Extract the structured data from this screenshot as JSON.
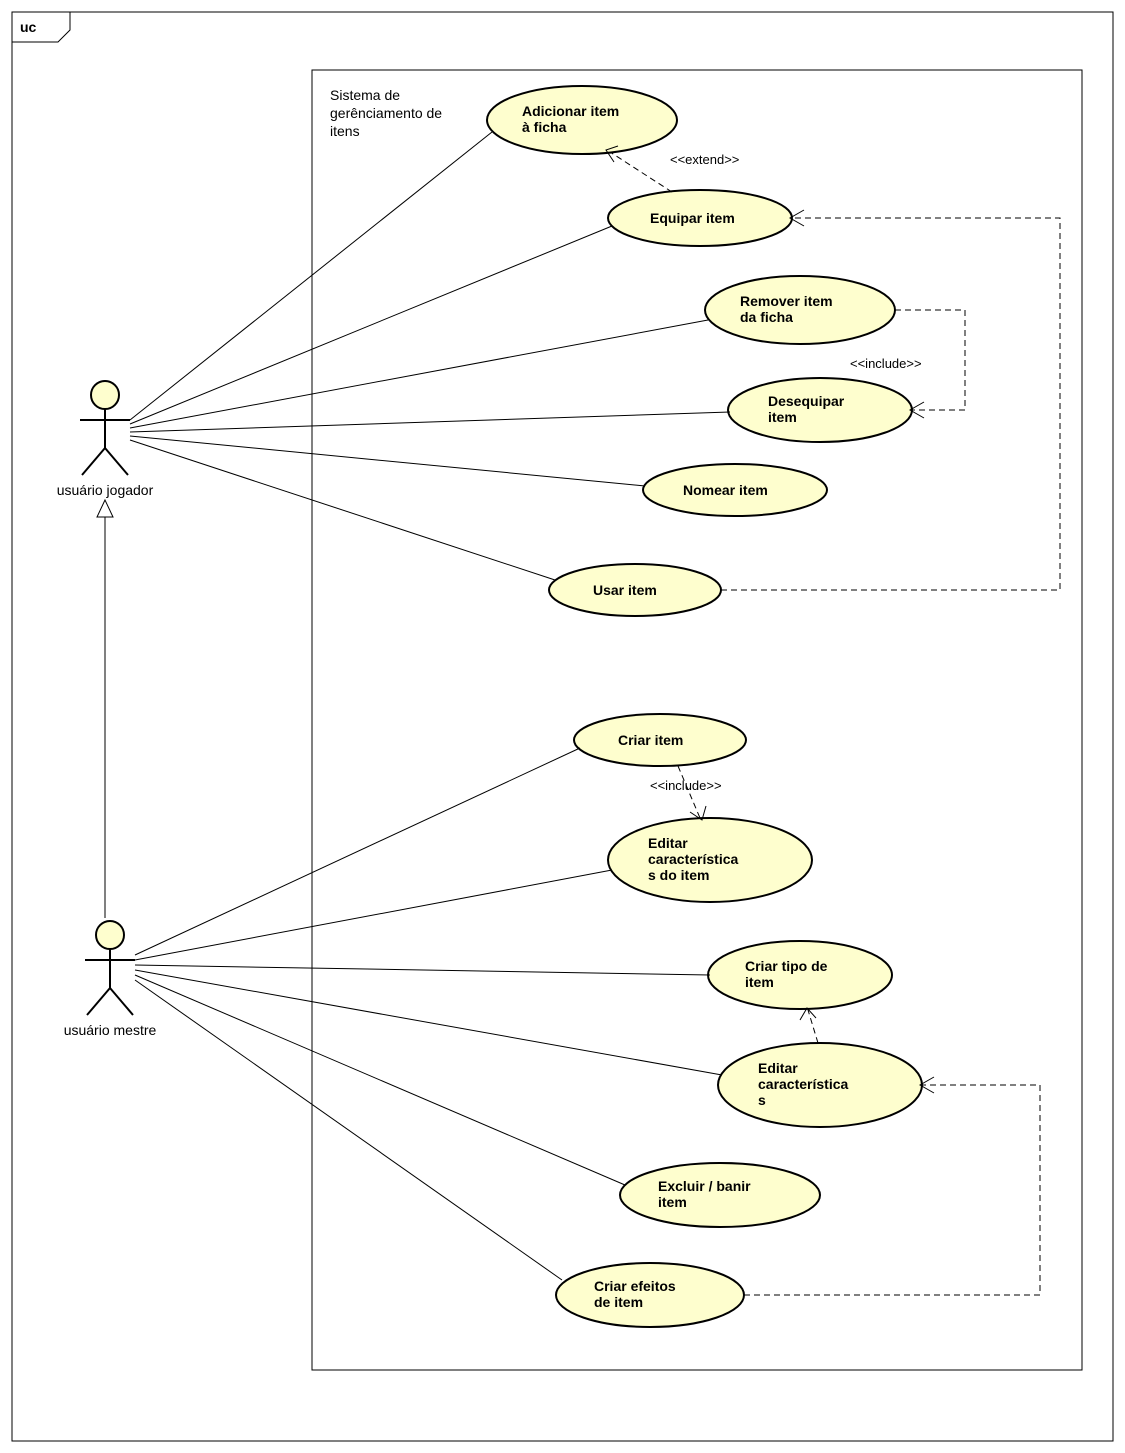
{
  "frame": {
    "label": "uc"
  },
  "system": {
    "title": "Sistema de\ngerênciamento de\nitens"
  },
  "actors": {
    "player": {
      "label": "usuário jogador"
    },
    "master": {
      "label": "usuário mestre"
    }
  },
  "usecases": {
    "addItem": {
      "label": "Adicionar item\nà ficha"
    },
    "equipItem": {
      "label": "Equipar item"
    },
    "removeItem": {
      "label": "Remover item\nda ficha"
    },
    "unequipItem": {
      "label": "Desequipar\nitem"
    },
    "nameItem": {
      "label": "Nomear item"
    },
    "useItem": {
      "label": "Usar item"
    },
    "createItem": {
      "label": "Criar item"
    },
    "editItemChar": {
      "label": "Editar\ncaracterística\ns do item"
    },
    "createItemType": {
      "label": "Criar tipo de\nitem"
    },
    "editChar": {
      "label": "Editar\ncaracterística\ns"
    },
    "deleteBan": {
      "label": "Excluir / banir\nitem"
    },
    "createEffects": {
      "label": "Criar efeitos\nde item"
    }
  },
  "relations": {
    "extend": {
      "label": "<<extend>>"
    },
    "include": {
      "label": "<<include>>"
    }
  },
  "chart_data": {
    "type": "uml_use_case",
    "frame_label": "uc",
    "system_boundary": "Sistema de gerênciamento de itens",
    "actors": [
      {
        "id": "player",
        "name": "usuário jogador"
      },
      {
        "id": "master",
        "name": "usuário mestre",
        "generalizes": "player"
      }
    ],
    "use_cases": [
      {
        "id": "addItem",
        "name": "Adicionar item à ficha"
      },
      {
        "id": "equipItem",
        "name": "Equipar item"
      },
      {
        "id": "removeItem",
        "name": "Remover item da ficha"
      },
      {
        "id": "unequipItem",
        "name": "Desequipar item"
      },
      {
        "id": "nameItem",
        "name": "Nomear item"
      },
      {
        "id": "useItem",
        "name": "Usar item"
      },
      {
        "id": "createItem",
        "name": "Criar item"
      },
      {
        "id": "editItemChar",
        "name": "Editar características do item"
      },
      {
        "id": "createItemType",
        "name": "Criar tipo de item"
      },
      {
        "id": "editChar",
        "name": "Editar características"
      },
      {
        "id": "deleteBan",
        "name": "Excluir / banir item"
      },
      {
        "id": "createEffects",
        "name": "Criar efeitos de item"
      }
    ],
    "associations": [
      {
        "actor": "player",
        "use_case": "addItem"
      },
      {
        "actor": "player",
        "use_case": "equipItem"
      },
      {
        "actor": "player",
        "use_case": "removeItem"
      },
      {
        "actor": "player",
        "use_case": "unequipItem"
      },
      {
        "actor": "player",
        "use_case": "nameItem"
      },
      {
        "actor": "player",
        "use_case": "useItem"
      },
      {
        "actor": "master",
        "use_case": "createItem"
      },
      {
        "actor": "master",
        "use_case": "editItemChar"
      },
      {
        "actor": "master",
        "use_case": "createItemType"
      },
      {
        "actor": "master",
        "use_case": "editChar"
      },
      {
        "actor": "master",
        "use_case": "deleteBan"
      },
      {
        "actor": "master",
        "use_case": "createEffects"
      }
    ],
    "dependencies": [
      {
        "from": "equipItem",
        "to": "addItem",
        "stereotype": "extend"
      },
      {
        "from": "removeItem",
        "to": "unequipItem",
        "stereotype": "include"
      },
      {
        "from": "createItem",
        "to": "editItemChar",
        "stereotype": "include"
      },
      {
        "from": "useItem",
        "to": "equipItem",
        "stereotype": "dependency"
      },
      {
        "from": "editChar",
        "to": "createItemType",
        "stereotype": "dependency"
      },
      {
        "from": "createEffects",
        "to": "editChar",
        "stereotype": "dependency"
      }
    ],
    "generalizations": [
      {
        "child": "master",
        "parent": "player"
      }
    ]
  }
}
